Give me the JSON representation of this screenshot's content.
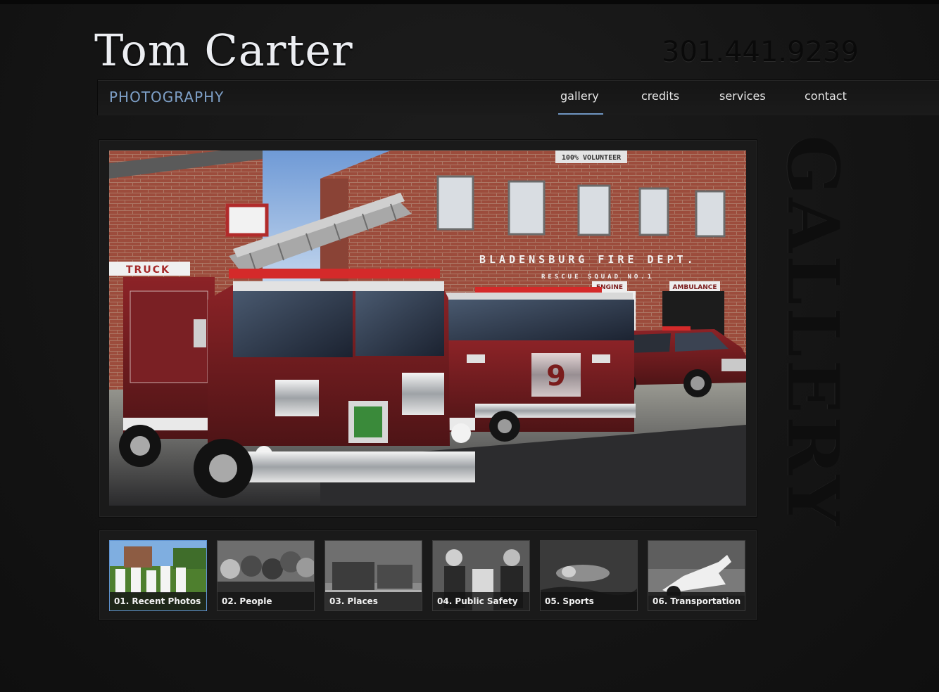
{
  "header": {
    "name": "Tom Carter",
    "subtitle": "PHOTOGRAPHY",
    "phone": "301.441.9239"
  },
  "nav": {
    "items": [
      {
        "label": "gallery",
        "active": true
      },
      {
        "label": "credits"
      },
      {
        "label": "services"
      },
      {
        "label": "contact"
      }
    ]
  },
  "main_photo": {
    "sign_station": "BLADENSBURG FIRE DEPT.",
    "sign_rescue": "RESCUE SQUAD NO.1",
    "sign_volunteer": "100% VOLUNTEER",
    "sign_truck": "TRUCK",
    "sign_engine": "ENGINE",
    "sign_ambulance": "AMBULANCE",
    "engine_number": "9"
  },
  "side_title": "GALLERY",
  "gallery": {
    "thumbnails": [
      {
        "label": "01. Recent Photos",
        "active": true
      },
      {
        "label": "02. People"
      },
      {
        "label": "03. Places"
      },
      {
        "label": "04. Public Safety"
      },
      {
        "label": "05. Sports"
      },
      {
        "label": "06. Transportation"
      }
    ]
  },
  "colors": {
    "accent": "#6f95c2",
    "subtitle": "#7ea0c8",
    "background": "#141414",
    "engine_red": "#6e1a1c"
  }
}
